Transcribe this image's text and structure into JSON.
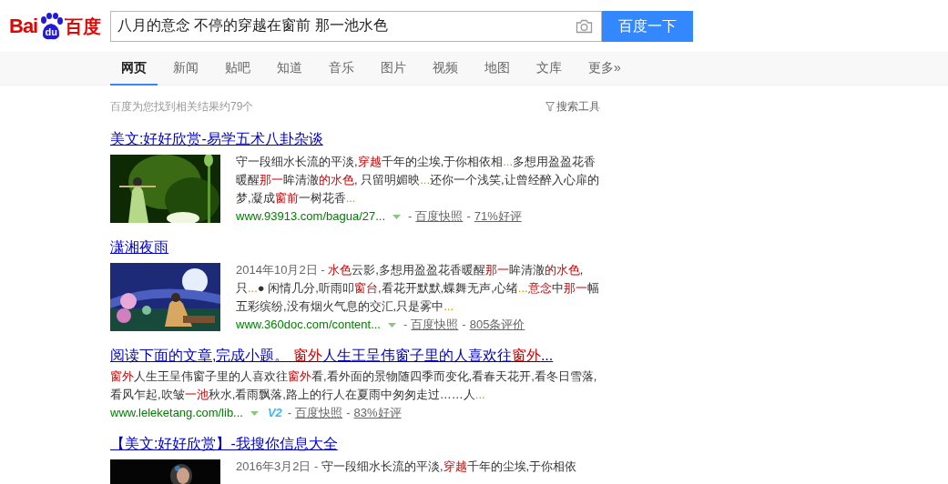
{
  "header": {
    "logo": {
      "left": "Bai",
      "paw": "du",
      "right": "百度"
    },
    "search": {
      "value": "八月的意念 不停的穿越在窗前 那一池水色"
    },
    "submit_button": "百度一下"
  },
  "tabs": [
    {
      "label": "网页",
      "selected": true
    },
    {
      "label": "新闻",
      "selected": false
    },
    {
      "label": "贴吧",
      "selected": false
    },
    {
      "label": "知道",
      "selected": false
    },
    {
      "label": "音乐",
      "selected": false
    },
    {
      "label": "图片",
      "selected": false
    },
    {
      "label": "视频",
      "selected": false
    },
    {
      "label": "地图",
      "selected": false
    },
    {
      "label": "文库",
      "selected": false
    },
    {
      "label": "更多»",
      "selected": false
    }
  ],
  "result_count": "百度为您找到相关结果约79个",
  "search_tools": "搜索工具",
  "results": [
    {
      "title": [
        {
          "text": "美文:好好欣赏-易学五术八卦杂谈",
          "kind": "plain"
        }
      ],
      "image": {
        "kind": "picture"
      },
      "snippet": [
        {
          "text": "守一段细水长流的平淡,",
          "kind": "plain"
        },
        {
          "text": "穿越",
          "kind": "em"
        },
        {
          "text": "千年的尘埃,于你相依相",
          "kind": "plain"
        },
        {
          "text": "...",
          "kind": "dots"
        },
        {
          "text": "多想用盈盈花香暖醒",
          "kind": "plain"
        },
        {
          "text": "那一",
          "kind": "em"
        },
        {
          "text": "眸清澈",
          "kind": "plain"
        },
        {
          "text": "的水色",
          "kind": "em"
        },
        {
          "text": ", 只留明媚映",
          "kind": "plain"
        },
        {
          "text": "...",
          "kind": "dots"
        },
        {
          "text": "还你一个浅笑,让曾经醉入心扉的梦,凝成",
          "kind": "plain"
        },
        {
          "text": "窗前",
          "kind": "em"
        },
        {
          "text": "一树花香",
          "kind": "plain"
        },
        {
          "text": "...",
          "kind": "dots"
        }
      ],
      "url": "www.93913.com/bagua/27...",
      "verified": false,
      "meta": [
        {
          "separator": "-",
          "text": "百度快照"
        },
        {
          "separator": "-",
          "text": "71%好评"
        }
      ]
    },
    {
      "title": [
        {
          "text": "潇湘夜雨",
          "kind": "plain"
        }
      ],
      "image": {
        "kind": "picture"
      },
      "date": "2014年10月2日",
      "date_separator": "-",
      "snippet": [
        {
          "text": "水色",
          "kind": "em"
        },
        {
          "text": "云影,多想用盈盈花香暖醒",
          "kind": "plain"
        },
        {
          "text": "那一",
          "kind": "em"
        },
        {
          "text": "眸清澈",
          "kind": "plain"
        },
        {
          "text": "的水色",
          "kind": "em"
        },
        {
          "text": ",只",
          "kind": "plain"
        },
        {
          "text": "...",
          "kind": "dots"
        },
        {
          "text": "● 闲情几分,听雨叩",
          "kind": "plain"
        },
        {
          "text": "窗台",
          "kind": "em"
        },
        {
          "text": ",看花开默默,蝶舞无声,心绪",
          "kind": "plain"
        },
        {
          "text": "...",
          "kind": "dots"
        },
        {
          "text": "意念",
          "kind": "em"
        },
        {
          "text": "中",
          "kind": "plain"
        },
        {
          "text": "那一",
          "kind": "em"
        },
        {
          "text": "幅五彩缤纷,没有烟火气息的交汇,只是雾中",
          "kind": "plain"
        },
        {
          "text": "...",
          "kind": "dots"
        }
      ],
      "url": "www.360doc.com/content...",
      "verified": false,
      "meta": [
        {
          "separator": "-",
          "text": "百度快照"
        },
        {
          "separator": "-",
          "text": "805条评价"
        }
      ]
    },
    {
      "title": [
        {
          "text": "阅读下面的文章,完成小题。 ",
          "kind": "plain"
        },
        {
          "text": "窗外",
          "kind": "em"
        },
        {
          "text": "人生王呈伟窗子里的人喜欢往",
          "kind": "plain"
        },
        {
          "text": "窗外",
          "kind": "em"
        },
        {
          "text": "...",
          "kind": "plain"
        }
      ],
      "snippet": [
        {
          "text": "窗外",
          "kind": "em"
        },
        {
          "text": "人生王呈伟窗子里的人喜欢往",
          "kind": "plain"
        },
        {
          "text": "窗外",
          "kind": "em"
        },
        {
          "text": "看,看外面的景物随四季而变化,看春天花开,看冬日雪落,看风乍起,吹皱",
          "kind": "plain"
        },
        {
          "text": "一池",
          "kind": "em"
        },
        {
          "text": "秋水,看雨飘落,路上的行人在夏雨中匆匆走过……人",
          "kind": "plain"
        },
        {
          "text": "...",
          "kind": "dots"
        }
      ],
      "url": "www.leleketang.com/lib...",
      "verified": true,
      "badge": "V2",
      "meta": [
        {
          "separator": "-",
          "text": "百度快照"
        },
        {
          "separator": "-",
          "text": "83%好评"
        }
      ]
    },
    {
      "title": [
        {
          "text": "【美文:好好欣赏】-我搜你信息大全",
          "kind": "plain"
        }
      ],
      "image": {
        "kind": "picture"
      },
      "date": "2016年3月2日",
      "date_separator": "-",
      "snippet": [
        {
          "text": "守一段细水长流的平淡,",
          "kind": "plain"
        },
        {
          "text": "穿越",
          "kind": "em"
        },
        {
          "text": "千年的尘埃,于你相依",
          "kind": "plain"
        }
      ]
    }
  ]
}
